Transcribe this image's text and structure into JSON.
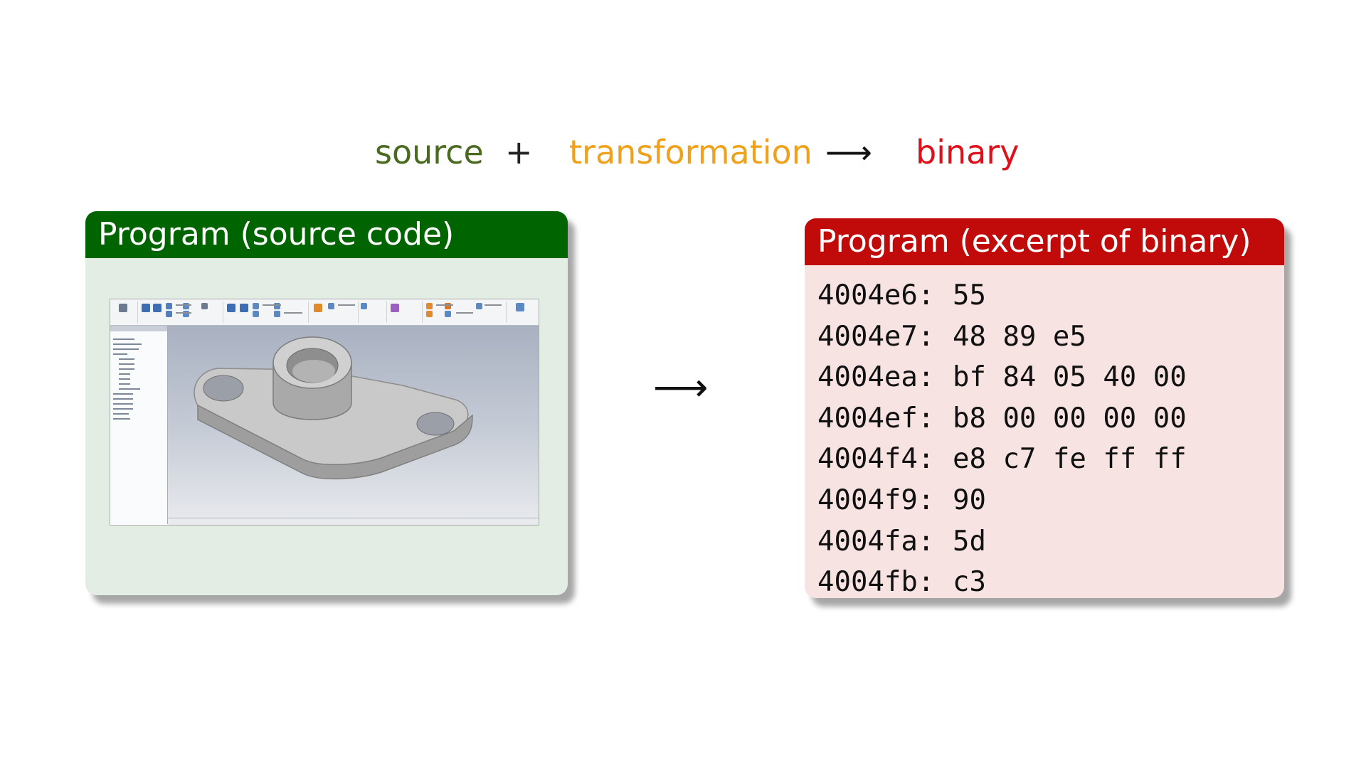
{
  "equation": {
    "source": "source",
    "plus": "+",
    "transformation": "transformation",
    "arrow": "⟶",
    "binary": "binary"
  },
  "middle_arrow": "⟶",
  "source_block": {
    "title": "Program (source code)"
  },
  "binary_block": {
    "title": "Program (excerpt of binary)",
    "lines": [
      {
        "addr": "4004e6:",
        "bytes": "55"
      },
      {
        "addr": "4004e7:",
        "bytes": "48 89 e5"
      },
      {
        "addr": "4004ea:",
        "bytes": "bf 84 05 40 00"
      },
      {
        "addr": "4004ef:",
        "bytes": "b8 00 00 00 00"
      },
      {
        "addr": "4004f4:",
        "bytes": "e8 c7 fe ff ff"
      },
      {
        "addr": "4004f9:",
        "bytes": "90"
      },
      {
        "addr": "4004fa:",
        "bytes": "5d"
      },
      {
        "addr": "4004fb:",
        "bytes": "c3"
      }
    ]
  },
  "colors": {
    "source": "#4a6b1f",
    "transformation": "#f0a11b",
    "binary": "#e0101a",
    "source_header": "#006400",
    "binary_header": "#c10a0a"
  }
}
